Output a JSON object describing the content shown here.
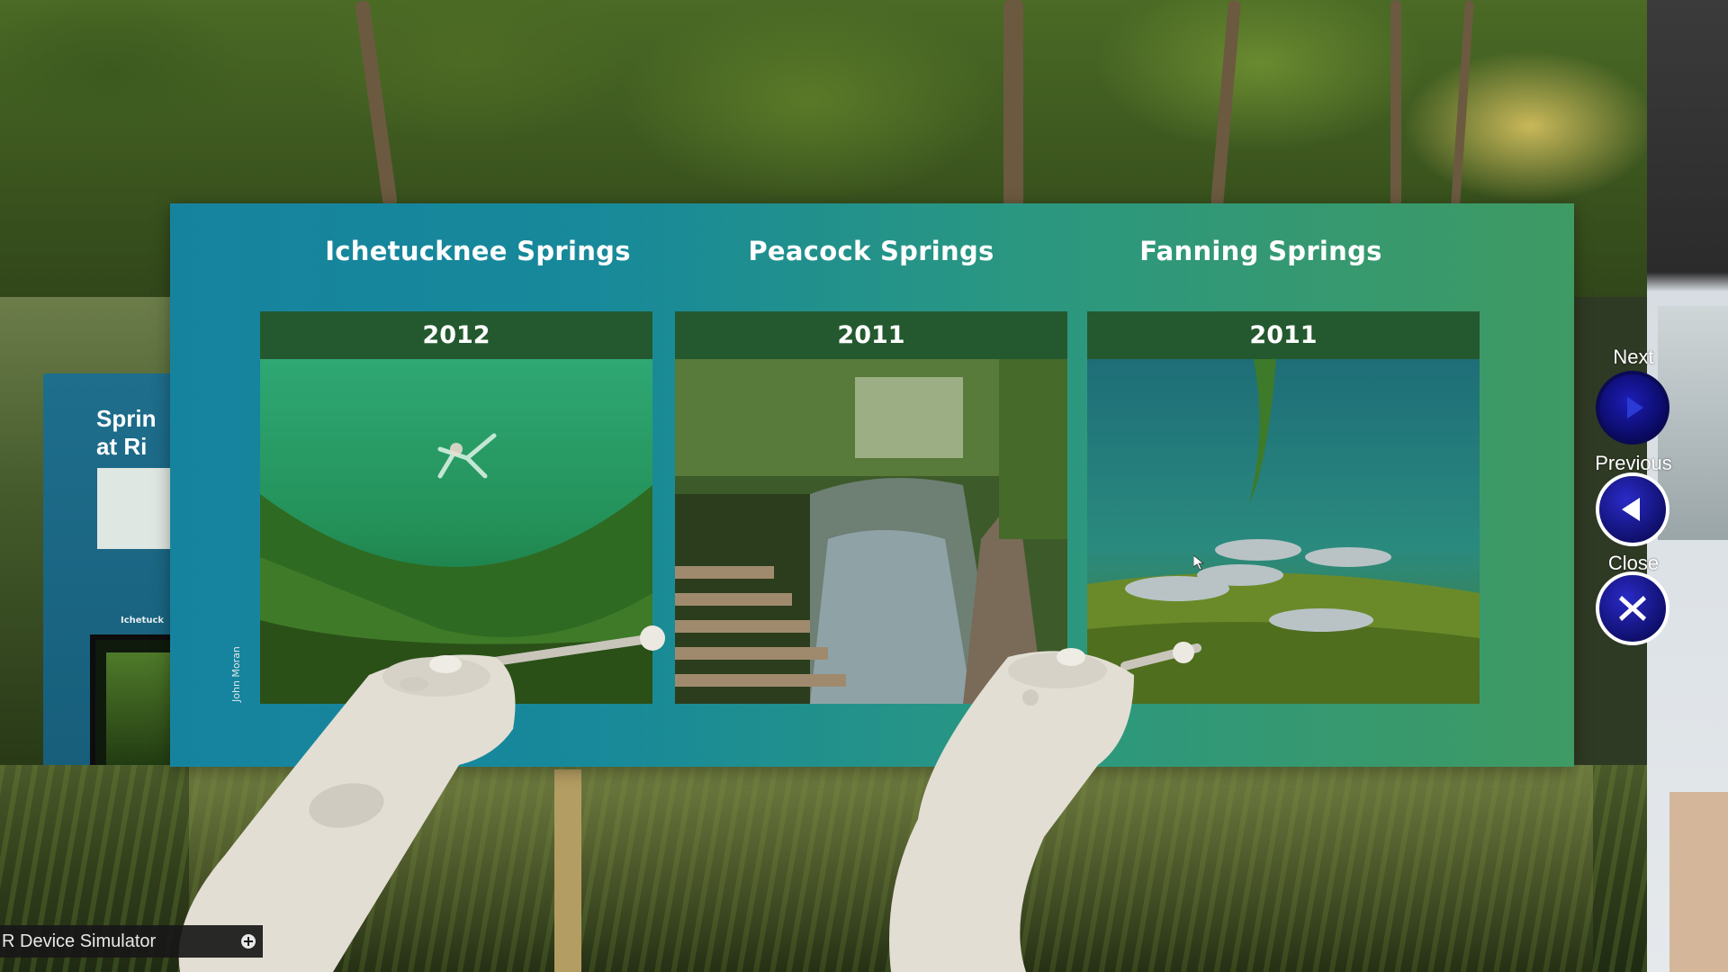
{
  "board": {
    "columns": [
      {
        "title": "Ichetucknee Springs",
        "year": "2012",
        "photo": "underwater-swimmer-photo"
      },
      {
        "title": "Peacock Springs",
        "year": "2011",
        "photo": "creek-boardwalk-photo"
      },
      {
        "title": "Fanning Springs",
        "year": "2011",
        "photo": "mullet-fish-photo"
      }
    ],
    "photo_credit": "John Moran"
  },
  "background_exhibit": {
    "title_line1": "Sprin",
    "title_line2": "at Ri",
    "small_label": "Ichetuck"
  },
  "navigation": {
    "next_label": "Next",
    "previous_label": "Previous",
    "close_label": "Close"
  },
  "simulator": {
    "label": "R Device Simulator"
  },
  "colors": {
    "board_left": "#16839e",
    "board_right": "#3f9a63",
    "card_header": "#24592f",
    "nav_button": "#10106e"
  },
  "icons": {
    "next": "play-right-icon",
    "previous": "play-left-icon",
    "close": "x-icon",
    "add": "plus-circle-icon"
  }
}
